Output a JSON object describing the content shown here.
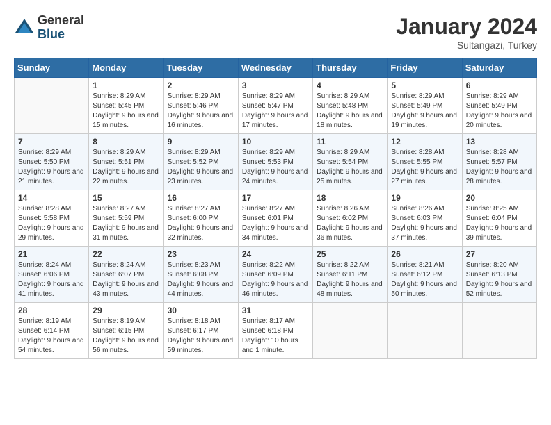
{
  "logo": {
    "general": "General",
    "blue": "Blue"
  },
  "title": {
    "month": "January 2024",
    "location": "Sultangazi, Turkey"
  },
  "columns": [
    "Sunday",
    "Monday",
    "Tuesday",
    "Wednesday",
    "Thursday",
    "Friday",
    "Saturday"
  ],
  "weeks": [
    [
      {
        "day": "",
        "sunrise": "",
        "sunset": "",
        "daylight": ""
      },
      {
        "day": "1",
        "sunrise": "Sunrise: 8:29 AM",
        "sunset": "Sunset: 5:45 PM",
        "daylight": "Daylight: 9 hours and 15 minutes."
      },
      {
        "day": "2",
        "sunrise": "Sunrise: 8:29 AM",
        "sunset": "Sunset: 5:46 PM",
        "daylight": "Daylight: 9 hours and 16 minutes."
      },
      {
        "day": "3",
        "sunrise": "Sunrise: 8:29 AM",
        "sunset": "Sunset: 5:47 PM",
        "daylight": "Daylight: 9 hours and 17 minutes."
      },
      {
        "day": "4",
        "sunrise": "Sunrise: 8:29 AM",
        "sunset": "Sunset: 5:48 PM",
        "daylight": "Daylight: 9 hours and 18 minutes."
      },
      {
        "day": "5",
        "sunrise": "Sunrise: 8:29 AM",
        "sunset": "Sunset: 5:49 PM",
        "daylight": "Daylight: 9 hours and 19 minutes."
      },
      {
        "day": "6",
        "sunrise": "Sunrise: 8:29 AM",
        "sunset": "Sunset: 5:49 PM",
        "daylight": "Daylight: 9 hours and 20 minutes."
      }
    ],
    [
      {
        "day": "7",
        "sunrise": "Sunrise: 8:29 AM",
        "sunset": "Sunset: 5:50 PM",
        "daylight": "Daylight: 9 hours and 21 minutes."
      },
      {
        "day": "8",
        "sunrise": "Sunrise: 8:29 AM",
        "sunset": "Sunset: 5:51 PM",
        "daylight": "Daylight: 9 hours and 22 minutes."
      },
      {
        "day": "9",
        "sunrise": "Sunrise: 8:29 AM",
        "sunset": "Sunset: 5:52 PM",
        "daylight": "Daylight: 9 hours and 23 minutes."
      },
      {
        "day": "10",
        "sunrise": "Sunrise: 8:29 AM",
        "sunset": "Sunset: 5:53 PM",
        "daylight": "Daylight: 9 hours and 24 minutes."
      },
      {
        "day": "11",
        "sunrise": "Sunrise: 8:29 AM",
        "sunset": "Sunset: 5:54 PM",
        "daylight": "Daylight: 9 hours and 25 minutes."
      },
      {
        "day": "12",
        "sunrise": "Sunrise: 8:28 AM",
        "sunset": "Sunset: 5:55 PM",
        "daylight": "Daylight: 9 hours and 27 minutes."
      },
      {
        "day": "13",
        "sunrise": "Sunrise: 8:28 AM",
        "sunset": "Sunset: 5:57 PM",
        "daylight": "Daylight: 9 hours and 28 minutes."
      }
    ],
    [
      {
        "day": "14",
        "sunrise": "Sunrise: 8:28 AM",
        "sunset": "Sunset: 5:58 PM",
        "daylight": "Daylight: 9 hours and 29 minutes."
      },
      {
        "day": "15",
        "sunrise": "Sunrise: 8:27 AM",
        "sunset": "Sunset: 5:59 PM",
        "daylight": "Daylight: 9 hours and 31 minutes."
      },
      {
        "day": "16",
        "sunrise": "Sunrise: 8:27 AM",
        "sunset": "Sunset: 6:00 PM",
        "daylight": "Daylight: 9 hours and 32 minutes."
      },
      {
        "day": "17",
        "sunrise": "Sunrise: 8:27 AM",
        "sunset": "Sunset: 6:01 PM",
        "daylight": "Daylight: 9 hours and 34 minutes."
      },
      {
        "day": "18",
        "sunrise": "Sunrise: 8:26 AM",
        "sunset": "Sunset: 6:02 PM",
        "daylight": "Daylight: 9 hours and 36 minutes."
      },
      {
        "day": "19",
        "sunrise": "Sunrise: 8:26 AM",
        "sunset": "Sunset: 6:03 PM",
        "daylight": "Daylight: 9 hours and 37 minutes."
      },
      {
        "day": "20",
        "sunrise": "Sunrise: 8:25 AM",
        "sunset": "Sunset: 6:04 PM",
        "daylight": "Daylight: 9 hours and 39 minutes."
      }
    ],
    [
      {
        "day": "21",
        "sunrise": "Sunrise: 8:24 AM",
        "sunset": "Sunset: 6:06 PM",
        "daylight": "Daylight: 9 hours and 41 minutes."
      },
      {
        "day": "22",
        "sunrise": "Sunrise: 8:24 AM",
        "sunset": "Sunset: 6:07 PM",
        "daylight": "Daylight: 9 hours and 43 minutes."
      },
      {
        "day": "23",
        "sunrise": "Sunrise: 8:23 AM",
        "sunset": "Sunset: 6:08 PM",
        "daylight": "Daylight: 9 hours and 44 minutes."
      },
      {
        "day": "24",
        "sunrise": "Sunrise: 8:22 AM",
        "sunset": "Sunset: 6:09 PM",
        "daylight": "Daylight: 9 hours and 46 minutes."
      },
      {
        "day": "25",
        "sunrise": "Sunrise: 8:22 AM",
        "sunset": "Sunset: 6:11 PM",
        "daylight": "Daylight: 9 hours and 48 minutes."
      },
      {
        "day": "26",
        "sunrise": "Sunrise: 8:21 AM",
        "sunset": "Sunset: 6:12 PM",
        "daylight": "Daylight: 9 hours and 50 minutes."
      },
      {
        "day": "27",
        "sunrise": "Sunrise: 8:20 AM",
        "sunset": "Sunset: 6:13 PM",
        "daylight": "Daylight: 9 hours and 52 minutes."
      }
    ],
    [
      {
        "day": "28",
        "sunrise": "Sunrise: 8:19 AM",
        "sunset": "Sunset: 6:14 PM",
        "daylight": "Daylight: 9 hours and 54 minutes."
      },
      {
        "day": "29",
        "sunrise": "Sunrise: 8:19 AM",
        "sunset": "Sunset: 6:15 PM",
        "daylight": "Daylight: 9 hours and 56 minutes."
      },
      {
        "day": "30",
        "sunrise": "Sunrise: 8:18 AM",
        "sunset": "Sunset: 6:17 PM",
        "daylight": "Daylight: 9 hours and 59 minutes."
      },
      {
        "day": "31",
        "sunrise": "Sunrise: 8:17 AM",
        "sunset": "Sunset: 6:18 PM",
        "daylight": "Daylight: 10 hours and 1 minute."
      },
      {
        "day": "",
        "sunrise": "",
        "sunset": "",
        "daylight": ""
      },
      {
        "day": "",
        "sunrise": "",
        "sunset": "",
        "daylight": ""
      },
      {
        "day": "",
        "sunrise": "",
        "sunset": "",
        "daylight": ""
      }
    ]
  ]
}
